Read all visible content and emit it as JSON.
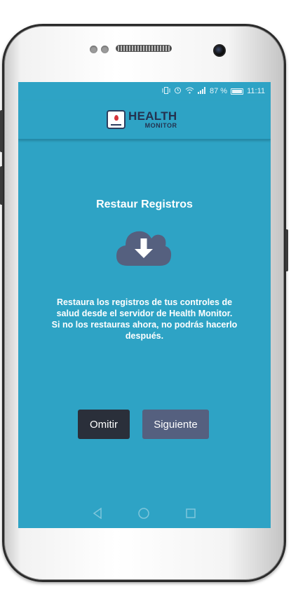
{
  "status_bar": {
    "battery_percent": "87 %",
    "time": "11:11"
  },
  "app": {
    "logo_line1": "HEALTH",
    "logo_line2": "MONITOR"
  },
  "screen": {
    "title": "Restaur Registros",
    "description_lines": [
      "Restaura los registros de tus controles de",
      "salud desde el servidor de Health Monitor.",
      "Si no los restauras ahora, no podrás hacerlo",
      "después."
    ],
    "icon": "cloud-download-icon"
  },
  "buttons": {
    "skip_label": "Omitir",
    "next_label": "Siguiente"
  },
  "navigation": {
    "icons": [
      "back-icon",
      "home-icon",
      "recent-apps-icon"
    ]
  },
  "colors": {
    "screen_background": "#2ea3c5",
    "skip_button": "#2a2f3a",
    "next_button": "#55607f",
    "cloud": "#55607f",
    "logo_text": "#24324f"
  }
}
